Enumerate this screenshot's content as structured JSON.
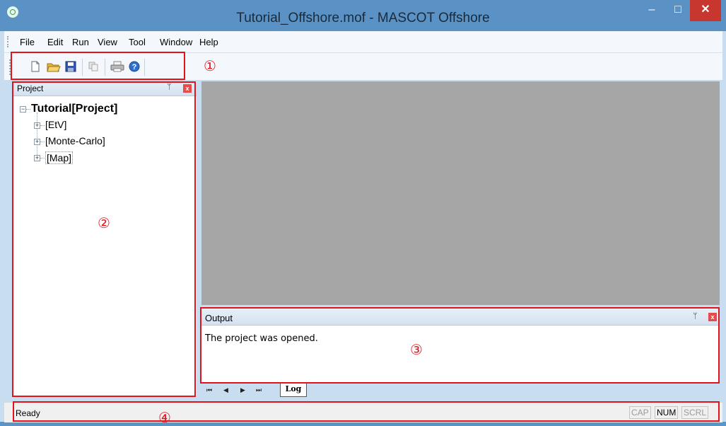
{
  "window": {
    "title": "Tutorial_Offshore.mof - MASCOT Offshore",
    "min_symbol": "–",
    "max_symbol": "□",
    "close_symbol": "✕"
  },
  "menu": [
    "File",
    "Edit",
    "Run",
    "View",
    "Tool",
    "Window",
    "Help"
  ],
  "toolbar": {
    "icons": [
      "new-file-icon",
      "open-folder-icon",
      "save-icon",
      "copy-icon",
      "print-icon",
      "help-icon"
    ]
  },
  "annotations": {
    "toolbar": "①",
    "project_panel": "②",
    "output_panel": "③",
    "status_bar": "④"
  },
  "project_panel": {
    "title": "Project",
    "pin_symbol": "ᛘ",
    "close_symbol": "x",
    "tree": {
      "root": "Tutorial[Project]",
      "children": [
        "[EtV]",
        "[Monte-Carlo]",
        "[Map]"
      ]
    }
  },
  "output_panel": {
    "title": "Output",
    "pin_symbol": "ᛘ",
    "close_symbol": "x",
    "message": "The project was opened.",
    "tabs": [
      "Log"
    ],
    "nav": [
      "⏮",
      "◀",
      "▶",
      "⏭"
    ]
  },
  "status_bar": {
    "text": "Ready",
    "indicators": [
      "CAP",
      "NUM",
      "SCRL"
    ]
  },
  "colors": {
    "title_bar": "#5a92c6",
    "close_button": "#c7372f",
    "annotation_red": "#e2131b",
    "mdi_background": "#a6a6a6"
  }
}
